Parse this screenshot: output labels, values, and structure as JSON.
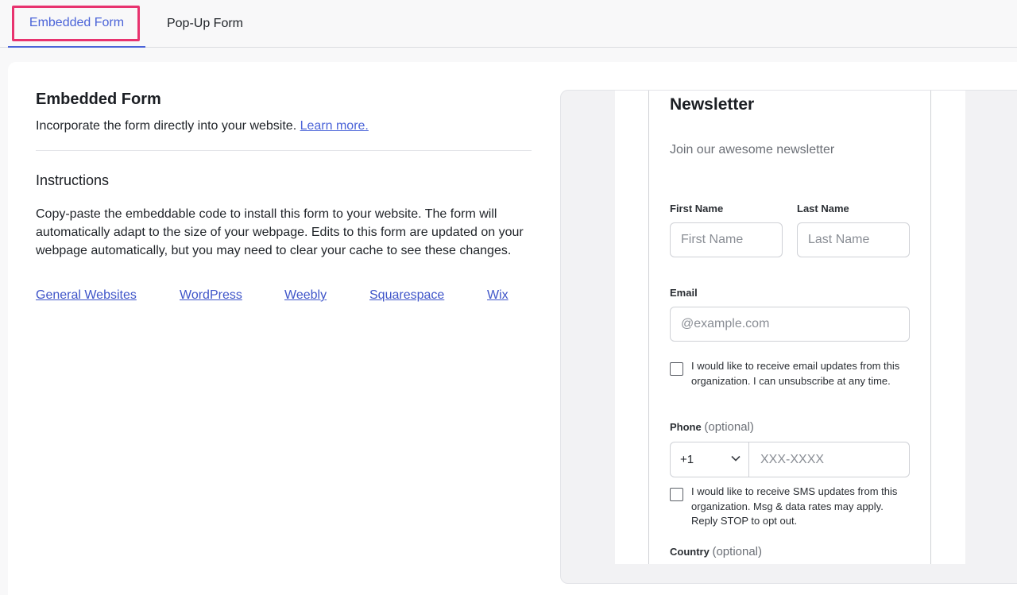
{
  "tabs": [
    {
      "label": "Embedded Form",
      "active": true
    },
    {
      "label": "Pop-Up Form",
      "active": false
    }
  ],
  "left": {
    "title": "Embedded Form",
    "subtitle": "Incorporate the form directly into your website.",
    "learn_more": "Learn more.",
    "instructions_title": "Instructions",
    "instructions_body": "Copy-paste the embeddable code to install this form to your website. The form will automatically adapt to the size of your webpage. Edits to this form are updated on your webpage automatically, but you may need to clear your cache to see these changes.",
    "platforms": [
      "General Websites",
      "WordPress",
      "Weebly",
      "Squarespace",
      "Wix"
    ]
  },
  "form": {
    "title": "Newsletter",
    "subtitle": "Join our awesome newsletter",
    "first_name_label": "First Name",
    "first_name_placeholder": "First Name",
    "last_name_label": "Last Name",
    "last_name_placeholder": "Last Name",
    "email_label": "Email",
    "email_placeholder": "@example.com",
    "email_consent": "I would like to receive email updates from this organization. I can unsubscribe at any time.",
    "phone_label": "Phone",
    "optional_text": "(optional)",
    "country_code": "+1",
    "phone_placeholder": "XXX-XXXX",
    "sms_consent": "I would like to receive SMS updates from this organization. Msg & data rates may apply. Reply STOP to opt out.",
    "country_label": "Country"
  },
  "colors": {
    "accent": "#4a63d8",
    "highlight": "#e8336f"
  },
  "icons": {
    "country_dropdown": "chevron-down-icon"
  }
}
